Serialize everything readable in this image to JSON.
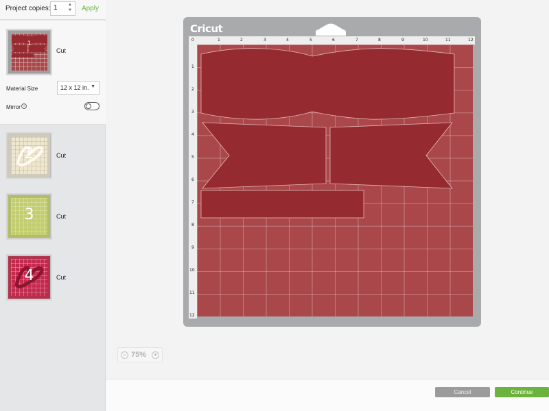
{
  "sidebar": {
    "project_copies_label": "Project copies:",
    "project_copies_value": "1",
    "apply_label": "Apply",
    "active_mat": {
      "operation": "Cut",
      "material_size_label": "Material Size",
      "material_size_value": "12 x 12 in.",
      "mirror_label": "Mirror",
      "mirror_enabled": false
    },
    "mats": [
      {
        "number": "2",
        "operation": "Cut",
        "color": "#efe6cf"
      },
      {
        "number": "3",
        "operation": "Cut",
        "color": "#c2cd6e"
      },
      {
        "number": "4",
        "operation": "Cut",
        "color": "#c5294d"
      }
    ]
  },
  "mat": {
    "brand": "Cricut",
    "color": "#a9474a",
    "ruler_top": [
      "0",
      "1",
      "2",
      "3",
      "4",
      "5",
      "6",
      "7",
      "8",
      "9",
      "10",
      "11",
      "12"
    ],
    "ruler_left": [
      "1",
      "2",
      "3",
      "4",
      "5",
      "6",
      "7",
      "8",
      "9",
      "10",
      "11",
      "12"
    ]
  },
  "zoom": {
    "value": "75%",
    "minus": "−",
    "plus": "+"
  },
  "footer": {
    "cancel_label": "Cancel",
    "continue_label": "Continue"
  },
  "colors": {
    "accent": "#6cb33e",
    "shape": "#952b30"
  },
  "icons": {
    "info": "info-icon",
    "stepper": "stepper-icon",
    "caret": "chevron-down-icon"
  }
}
